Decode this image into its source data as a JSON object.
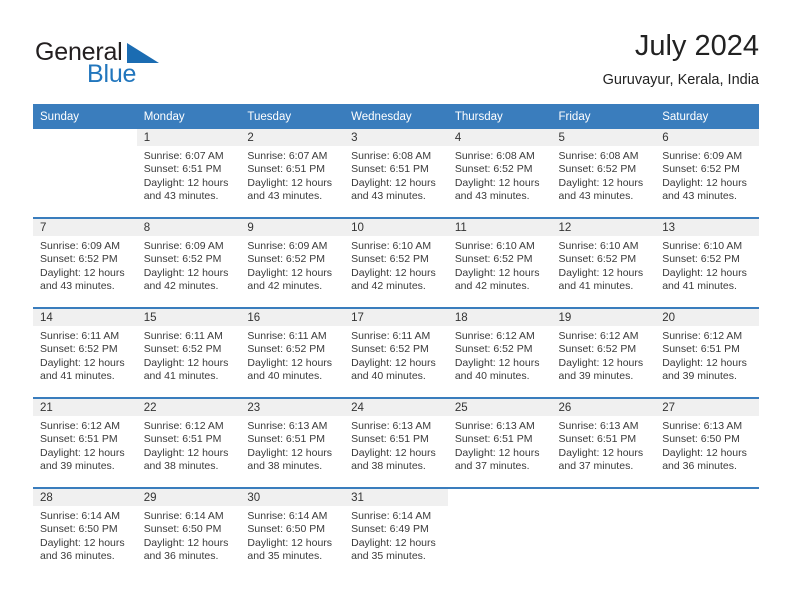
{
  "brand": {
    "name_part1": "General",
    "name_part2": "Blue",
    "logo_icon": "triangle-logo-icon",
    "colors": {
      "dark": "#231f20",
      "blue": "#2176bd"
    }
  },
  "header": {
    "title": "July 2024",
    "subtitle": "Guruvayur, Kerala, India"
  },
  "theme": {
    "header_bg": "#3a7dbd",
    "header_text": "#ffffff",
    "daynum_bg": "#f0f0f0",
    "body_text": "#3a3a3a"
  },
  "weekday_headers": [
    "Sunday",
    "Monday",
    "Tuesday",
    "Wednesday",
    "Thursday",
    "Friday",
    "Saturday"
  ],
  "weeks": [
    [
      {
        "day": "",
        "sunrise": "",
        "sunset": "",
        "daylight_line1": "",
        "daylight_line2": "",
        "blank": true
      },
      {
        "day": "1",
        "sunrise": "Sunrise: 6:07 AM",
        "sunset": "Sunset: 6:51 PM",
        "daylight_line1": "Daylight: 12 hours",
        "daylight_line2": "and 43 minutes."
      },
      {
        "day": "2",
        "sunrise": "Sunrise: 6:07 AM",
        "sunset": "Sunset: 6:51 PM",
        "daylight_line1": "Daylight: 12 hours",
        "daylight_line2": "and 43 minutes."
      },
      {
        "day": "3",
        "sunrise": "Sunrise: 6:08 AM",
        "sunset": "Sunset: 6:51 PM",
        "daylight_line1": "Daylight: 12 hours",
        "daylight_line2": "and 43 minutes."
      },
      {
        "day": "4",
        "sunrise": "Sunrise: 6:08 AM",
        "sunset": "Sunset: 6:52 PM",
        "daylight_line1": "Daylight: 12 hours",
        "daylight_line2": "and 43 minutes."
      },
      {
        "day": "5",
        "sunrise": "Sunrise: 6:08 AM",
        "sunset": "Sunset: 6:52 PM",
        "daylight_line1": "Daylight: 12 hours",
        "daylight_line2": "and 43 minutes."
      },
      {
        "day": "6",
        "sunrise": "Sunrise: 6:09 AM",
        "sunset": "Sunset: 6:52 PM",
        "daylight_line1": "Daylight: 12 hours",
        "daylight_line2": "and 43 minutes."
      }
    ],
    [
      {
        "day": "7",
        "sunrise": "Sunrise: 6:09 AM",
        "sunset": "Sunset: 6:52 PM",
        "daylight_line1": "Daylight: 12 hours",
        "daylight_line2": "and 43 minutes."
      },
      {
        "day": "8",
        "sunrise": "Sunrise: 6:09 AM",
        "sunset": "Sunset: 6:52 PM",
        "daylight_line1": "Daylight: 12 hours",
        "daylight_line2": "and 42 minutes."
      },
      {
        "day": "9",
        "sunrise": "Sunrise: 6:09 AM",
        "sunset": "Sunset: 6:52 PM",
        "daylight_line1": "Daylight: 12 hours",
        "daylight_line2": "and 42 minutes."
      },
      {
        "day": "10",
        "sunrise": "Sunrise: 6:10 AM",
        "sunset": "Sunset: 6:52 PM",
        "daylight_line1": "Daylight: 12 hours",
        "daylight_line2": "and 42 minutes."
      },
      {
        "day": "11",
        "sunrise": "Sunrise: 6:10 AM",
        "sunset": "Sunset: 6:52 PM",
        "daylight_line1": "Daylight: 12 hours",
        "daylight_line2": "and 42 minutes."
      },
      {
        "day": "12",
        "sunrise": "Sunrise: 6:10 AM",
        "sunset": "Sunset: 6:52 PM",
        "daylight_line1": "Daylight: 12 hours",
        "daylight_line2": "and 41 minutes."
      },
      {
        "day": "13",
        "sunrise": "Sunrise: 6:10 AM",
        "sunset": "Sunset: 6:52 PM",
        "daylight_line1": "Daylight: 12 hours",
        "daylight_line2": "and 41 minutes."
      }
    ],
    [
      {
        "day": "14",
        "sunrise": "Sunrise: 6:11 AM",
        "sunset": "Sunset: 6:52 PM",
        "daylight_line1": "Daylight: 12 hours",
        "daylight_line2": "and 41 minutes."
      },
      {
        "day": "15",
        "sunrise": "Sunrise: 6:11 AM",
        "sunset": "Sunset: 6:52 PM",
        "daylight_line1": "Daylight: 12 hours",
        "daylight_line2": "and 41 minutes."
      },
      {
        "day": "16",
        "sunrise": "Sunrise: 6:11 AM",
        "sunset": "Sunset: 6:52 PM",
        "daylight_line1": "Daylight: 12 hours",
        "daylight_line2": "and 40 minutes."
      },
      {
        "day": "17",
        "sunrise": "Sunrise: 6:11 AM",
        "sunset": "Sunset: 6:52 PM",
        "daylight_line1": "Daylight: 12 hours",
        "daylight_line2": "and 40 minutes."
      },
      {
        "day": "18",
        "sunrise": "Sunrise: 6:12 AM",
        "sunset": "Sunset: 6:52 PM",
        "daylight_line1": "Daylight: 12 hours",
        "daylight_line2": "and 40 minutes."
      },
      {
        "day": "19",
        "sunrise": "Sunrise: 6:12 AM",
        "sunset": "Sunset: 6:52 PM",
        "daylight_line1": "Daylight: 12 hours",
        "daylight_line2": "and 39 minutes."
      },
      {
        "day": "20",
        "sunrise": "Sunrise: 6:12 AM",
        "sunset": "Sunset: 6:51 PM",
        "daylight_line1": "Daylight: 12 hours",
        "daylight_line2": "and 39 minutes."
      }
    ],
    [
      {
        "day": "21",
        "sunrise": "Sunrise: 6:12 AM",
        "sunset": "Sunset: 6:51 PM",
        "daylight_line1": "Daylight: 12 hours",
        "daylight_line2": "and 39 minutes."
      },
      {
        "day": "22",
        "sunrise": "Sunrise: 6:12 AM",
        "sunset": "Sunset: 6:51 PM",
        "daylight_line1": "Daylight: 12 hours",
        "daylight_line2": "and 38 minutes."
      },
      {
        "day": "23",
        "sunrise": "Sunrise: 6:13 AM",
        "sunset": "Sunset: 6:51 PM",
        "daylight_line1": "Daylight: 12 hours",
        "daylight_line2": "and 38 minutes."
      },
      {
        "day": "24",
        "sunrise": "Sunrise: 6:13 AM",
        "sunset": "Sunset: 6:51 PM",
        "daylight_line1": "Daylight: 12 hours",
        "daylight_line2": "and 38 minutes."
      },
      {
        "day": "25",
        "sunrise": "Sunrise: 6:13 AM",
        "sunset": "Sunset: 6:51 PM",
        "daylight_line1": "Daylight: 12 hours",
        "daylight_line2": "and 37 minutes."
      },
      {
        "day": "26",
        "sunrise": "Sunrise: 6:13 AM",
        "sunset": "Sunset: 6:51 PM",
        "daylight_line1": "Daylight: 12 hours",
        "daylight_line2": "and 37 minutes."
      },
      {
        "day": "27",
        "sunrise": "Sunrise: 6:13 AM",
        "sunset": "Sunset: 6:50 PM",
        "daylight_line1": "Daylight: 12 hours",
        "daylight_line2": "and 36 minutes."
      }
    ],
    [
      {
        "day": "28",
        "sunrise": "Sunrise: 6:14 AM",
        "sunset": "Sunset: 6:50 PM",
        "daylight_line1": "Daylight: 12 hours",
        "daylight_line2": "and 36 minutes."
      },
      {
        "day": "29",
        "sunrise": "Sunrise: 6:14 AM",
        "sunset": "Sunset: 6:50 PM",
        "daylight_line1": "Daylight: 12 hours",
        "daylight_line2": "and 36 minutes."
      },
      {
        "day": "30",
        "sunrise": "Sunrise: 6:14 AM",
        "sunset": "Sunset: 6:50 PM",
        "daylight_line1": "Daylight: 12 hours",
        "daylight_line2": "and 35 minutes."
      },
      {
        "day": "31",
        "sunrise": "Sunrise: 6:14 AM",
        "sunset": "Sunset: 6:49 PM",
        "daylight_line1": "Daylight: 12 hours",
        "daylight_line2": "and 35 minutes."
      },
      {
        "day": "",
        "sunrise": "",
        "sunset": "",
        "daylight_line1": "",
        "daylight_line2": "",
        "blank": true
      },
      {
        "day": "",
        "sunrise": "",
        "sunset": "",
        "daylight_line1": "",
        "daylight_line2": "",
        "blank": true
      },
      {
        "day": "",
        "sunrise": "",
        "sunset": "",
        "daylight_line1": "",
        "daylight_line2": "",
        "blank": true
      }
    ]
  ]
}
